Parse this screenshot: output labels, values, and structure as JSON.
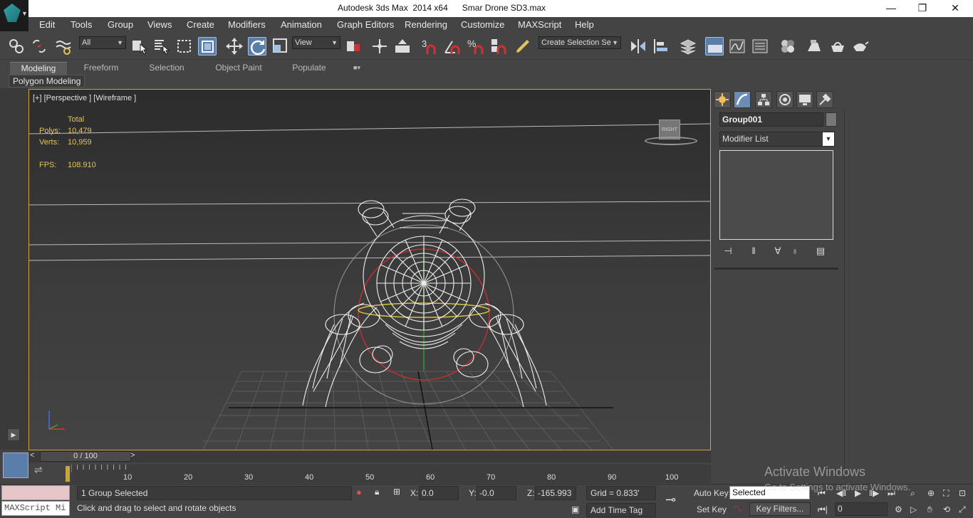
{
  "window": {
    "title": "Autodesk 3ds Max  2014 x64      Smar Drone SD3.max",
    "minimize": "—",
    "restore": "❐",
    "close": "✕"
  },
  "menu": [
    "Edit",
    "Tools",
    "Group",
    "Views",
    "Create",
    "Modifiers",
    "Animation",
    "Graph Editors",
    "Rendering",
    "Customize",
    "MAXScript",
    "Help"
  ],
  "toolbar": {
    "selection_filter": "All",
    "reference_coord": "View",
    "named_selection_placeholder": "Create Selection Se",
    "snap_3d_label": "3",
    "percent_label": "%"
  },
  "ribbon": {
    "tabs": [
      "Modeling",
      "Freeform",
      "Selection",
      "Object Paint",
      "Populate"
    ],
    "active_tab": "Modeling",
    "sub_panel": "Polygon Modeling"
  },
  "viewport": {
    "label": "[+] [Perspective ] [Wireframe ]",
    "stats": {
      "header": "Total",
      "polys_label": "Polys:",
      "polys": "10,479",
      "verts_label": "Verts:",
      "verts": "10,959",
      "fps_label": "FPS:",
      "fps": "108.910"
    },
    "viewcube_label": "RIGHT"
  },
  "command_panel": {
    "object_name": "Group001",
    "modifier_list": "Modifier List"
  },
  "timeline": {
    "slider": "0 / 100",
    "ticks": [
      "10",
      "20",
      "30",
      "40",
      "50",
      "60",
      "70",
      "80",
      "90",
      "100"
    ]
  },
  "status": {
    "maxscript_input": "MAXScript Mi",
    "selection_info": "1 Group Selected",
    "prompt": "Click and drag to select and rotate objects",
    "x_label": "X:",
    "x": "0.0",
    "y_label": "Y:",
    "y": "-0.0",
    "z_label": "Z:",
    "z": "-165.993",
    "grid": "Grid = 0.833'",
    "add_time_tag": "Add Time Tag",
    "auto_key": "Auto Key",
    "set_key": "Set Key",
    "key_mode": "Selected",
    "key_filters": "Key Filters...",
    "current_frame": "0"
  },
  "watermark": {
    "line1": "Activate Windows",
    "line2": "Go to Settings to activate Windows."
  },
  "colors": {
    "viewport_border": "#c7a640",
    "stats": "#e5c35b",
    "active_tool": "#5a7ea8"
  }
}
